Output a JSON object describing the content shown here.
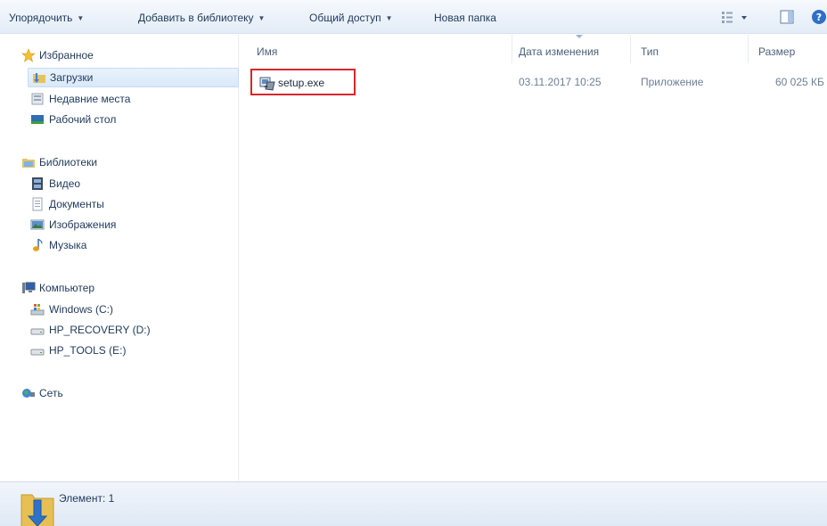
{
  "toolbar": {
    "organize": "Упорядочить",
    "add_library": "Добавить в библиотеку",
    "share": "Общий доступ",
    "new_folder": "Новая папка"
  },
  "sidebar": {
    "favorites": {
      "header": "Избранное",
      "items": [
        {
          "label": "Загрузки",
          "icon": "downloads-icon",
          "selected": true
        },
        {
          "label": "Недавние места",
          "icon": "recent-places-icon"
        },
        {
          "label": "Рабочий стол",
          "icon": "desktop-icon"
        }
      ]
    },
    "libraries": {
      "header": "Библиотеки",
      "items": [
        {
          "label": "Видео",
          "icon": "video-icon"
        },
        {
          "label": "Документы",
          "icon": "documents-icon"
        },
        {
          "label": "Изображения",
          "icon": "pictures-icon"
        },
        {
          "label": "Музыка",
          "icon": "music-icon"
        }
      ]
    },
    "computer": {
      "header": "Компьютер",
      "items": [
        {
          "label": "Windows (C:)",
          "icon": "windows-drive-icon"
        },
        {
          "label": "HP_RECOVERY (D:)",
          "icon": "drive-icon"
        },
        {
          "label": "HP_TOOLS (E:)",
          "icon": "drive-icon"
        }
      ]
    },
    "network": {
      "header": "Сеть"
    }
  },
  "columns": {
    "name": "Имя",
    "date": "Дата изменения",
    "type": "Тип",
    "size": "Размер"
  },
  "files": [
    {
      "name": "setup.exe",
      "date": "03.11.2017 10:25",
      "type": "Приложение",
      "size": "60 025 КБ",
      "icon": "setup-exe-icon"
    }
  ],
  "status": {
    "text": "Элемент: 1",
    "icon": "downloads-folder-icon"
  },
  "colors": {
    "selection_outline": "#d7262d",
    "text": "#1e395b"
  }
}
